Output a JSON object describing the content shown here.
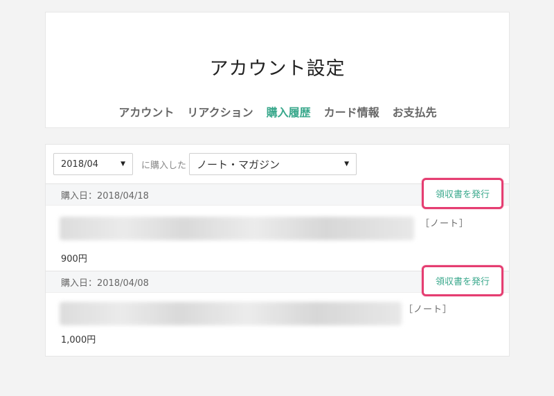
{
  "page": {
    "title": "アカウント設定",
    "tabs": [
      {
        "label": "アカウント",
        "active": false
      },
      {
        "label": "リアクション",
        "active": false
      },
      {
        "label": "購入履歴",
        "active": true
      },
      {
        "label": "カード情報",
        "active": false
      },
      {
        "label": "お支払先",
        "active": false
      }
    ]
  },
  "filters": {
    "month": "2018/04",
    "connector": "に購入した",
    "type": "ノート・マガジン"
  },
  "purchases": [
    {
      "date_label": "購入日：2018/04/18",
      "receipt_label": "領収書を発行",
      "tag": "［ノート］",
      "price": "900円"
    },
    {
      "date_label": "購入日：2018/04/08",
      "receipt_label": "領収書を発行",
      "tag": "［ノート］",
      "price": "1,000円"
    }
  ],
  "colors": {
    "accent": "#3aa88c",
    "highlight": "#e53d71",
    "background": "#f3f3f3"
  }
}
